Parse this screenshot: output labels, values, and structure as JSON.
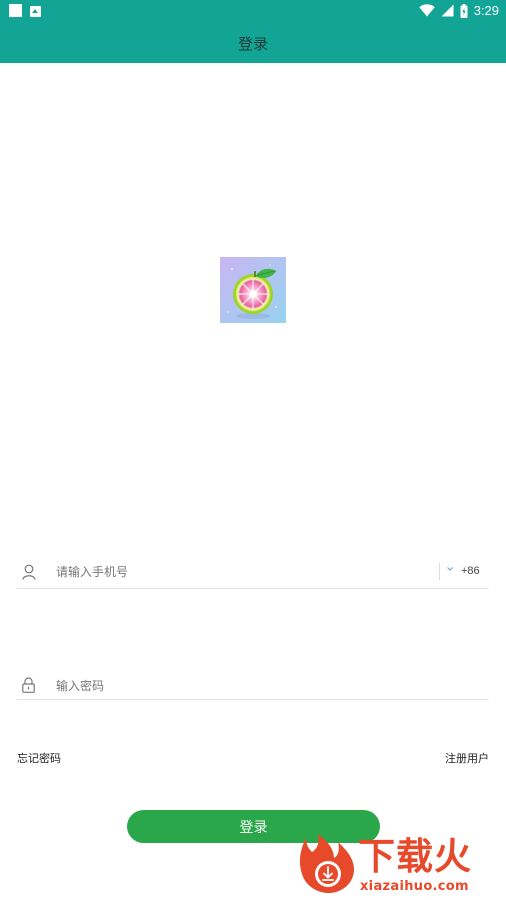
{
  "status_bar": {
    "time": "3:29"
  },
  "app_bar": {
    "title": "登录"
  },
  "form": {
    "phone_placeholder": "请输入手机号",
    "country_code": "+86",
    "password_placeholder": "输入密码"
  },
  "links": {
    "forgot_password": "忘记密码",
    "register": "注册用户"
  },
  "login_button": "登录",
  "watermark": {
    "cn": "下载火",
    "en": "xiazaihuo.com"
  },
  "colors": {
    "brand_teal": "#12a596",
    "button_green": "#2aa74a",
    "watermark_red": "#e74a2a"
  }
}
